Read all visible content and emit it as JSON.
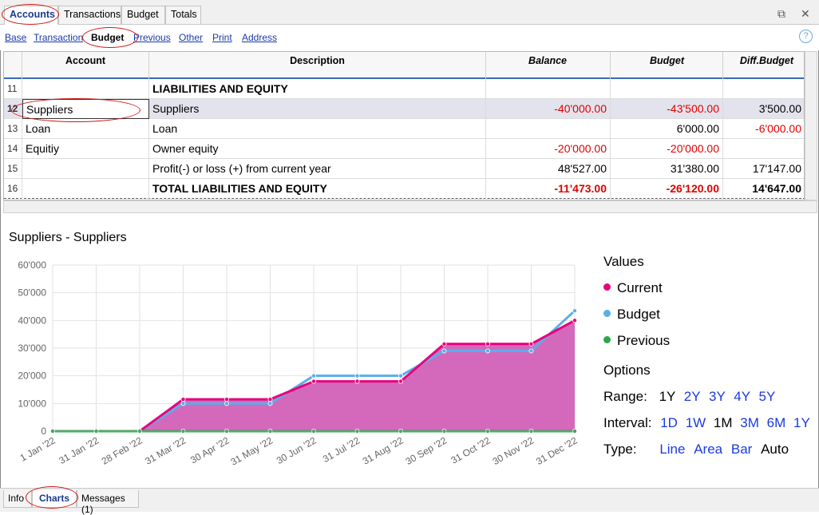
{
  "top_tabs": [
    "Accounts",
    "Transactions",
    "Budget",
    "Totals"
  ],
  "views": [
    "Base",
    "Transaction",
    "Budget",
    "Previous",
    "Other",
    "Print",
    "Address"
  ],
  "help_label": "?",
  "table": {
    "headers": [
      "Account",
      "Description",
      "Balance",
      "Budget",
      "Diff.Budget"
    ],
    "rows": [
      {
        "num": "11",
        "account": "",
        "description": "LIABILITIES AND EQUITY",
        "balance": "",
        "budget": "",
        "diff": ""
      },
      {
        "num": "12",
        "account": "Suppliers",
        "description": "Suppliers",
        "balance": "-40'000.00",
        "budget": "-43'500.00",
        "diff": "3'500.00"
      },
      {
        "num": "13",
        "account": "Loan",
        "description": "Loan",
        "balance": "",
        "budget": "6'000.00",
        "diff": "-6'000.00"
      },
      {
        "num": "14",
        "account": "Equitiy",
        "description": "Owner equity",
        "balance": "-20'000.00",
        "budget": "-20'000.00",
        "diff": ""
      },
      {
        "num": "15",
        "account": "",
        "description": "Profit(-) or loss (+) from current year",
        "balance": "48'527.00",
        "budget": "31'380.00",
        "diff": "17'147.00"
      },
      {
        "num": "16",
        "account": "",
        "description": "TOTAL LIABILITIES AND EQUITY",
        "balance": "-11'473.00",
        "budget": "-26'120.00",
        "diff": "14'647.00"
      }
    ]
  },
  "chart_title": "Suppliers - Suppliers",
  "legend": {
    "values_label": "Values",
    "items": [
      "Current",
      "Budget",
      "Previous"
    ],
    "options_label": "Options",
    "range_label": "Range:",
    "range_options": [
      "1Y",
      "2Y",
      "3Y",
      "4Y",
      "5Y"
    ],
    "range_selected": "1Y",
    "interval_label": "Interval:",
    "interval_options": [
      "1D",
      "1W",
      "1M",
      "3M",
      "6M",
      "1Y"
    ],
    "interval_selected": "1M",
    "type_label": "Type:",
    "type_options": [
      "Line",
      "Area",
      "Bar",
      "Auto"
    ],
    "type_selected": "Auto"
  },
  "colors": {
    "current": "#e8007e",
    "budget": "#5aaee8",
    "previous": "#2aa84a",
    "area": "#d261b8",
    "negative": "#e00000"
  },
  "chart_data": {
    "type": "area",
    "x": [
      "1 Jan '22",
      "31 Jan '22",
      "28 Feb '22",
      "31 Mar '22",
      "30 Apr '22",
      "31 May '22",
      "30 Jun '22",
      "31 Jul '22",
      "31 Aug '22",
      "30 Sep '22",
      "31 Oct '22",
      "30 Nov '22",
      "31 Dec '22"
    ],
    "series": [
      {
        "name": "Current",
        "values": [
          0,
          0,
          0,
          11500,
          11500,
          11500,
          18000,
          18000,
          18000,
          31500,
          31500,
          31500,
          40000
        ]
      },
      {
        "name": "Budget",
        "values": [
          0,
          0,
          0,
          10000,
          10000,
          10000,
          20000,
          20000,
          20000,
          29000,
          29000,
          29000,
          43500
        ]
      },
      {
        "name": "Previous",
        "values": [
          0,
          0,
          0,
          0,
          0,
          0,
          0,
          0,
          0,
          0,
          0,
          0,
          0
        ]
      }
    ],
    "yticks": [
      "0",
      "10'000",
      "20'000",
      "30'000",
      "40'000",
      "50'000",
      "60'000"
    ],
    "ylim": [
      0,
      60000
    ],
    "grid": true
  },
  "bottom_tabs": [
    "Info",
    "Charts",
    "Messages (1)"
  ]
}
